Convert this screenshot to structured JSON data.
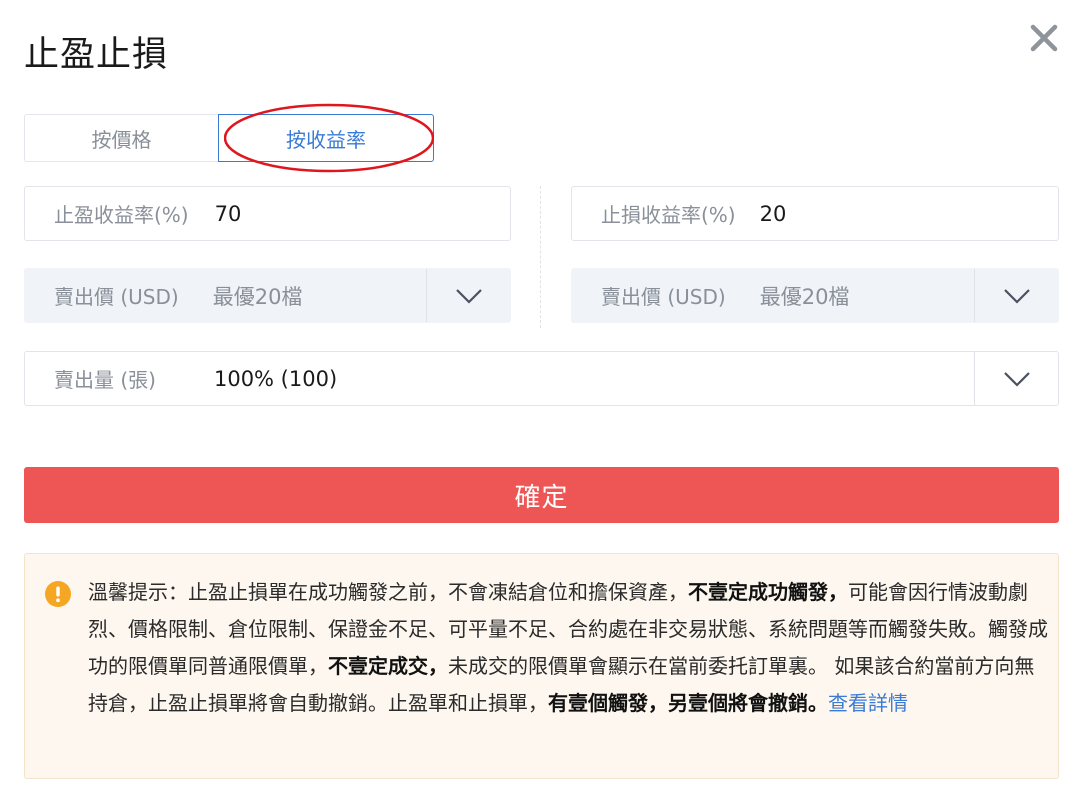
{
  "dialog": {
    "title": "止盈止損"
  },
  "tabs": [
    {
      "label": "按價格"
    },
    {
      "label": "按收益率",
      "active": true
    }
  ],
  "take_profit": {
    "label": "止盈收益率(%)",
    "value": "70"
  },
  "stop_loss": {
    "label": "止損收益率(%)",
    "value": "20"
  },
  "tp_sell_price": {
    "label": "賣出價 (USD)",
    "value": "最優20檔"
  },
  "sl_sell_price": {
    "label": "賣出價 (USD)",
    "value": "最優20檔"
  },
  "sell_qty": {
    "label": "賣出量 (張)",
    "value": "100% (100)"
  },
  "confirm_label": "確定",
  "notice": {
    "p1": "溫馨提示：止盈止損單在成功觸發之前，不會凍結倉位和擔保資產，",
    "b1": "不壹定成功觸發，",
    "p2": "可能會因行情波動劇烈、價格限制、倉位限制、保證金不足、可平量不足、合約處在非交易狀態、系統問題等而觸發失敗。觸發成功的限價單同普通限價單，",
    "b2": "不壹定成交，",
    "p3": "未成交的限價單會顯示在當前委托訂單裏。 如果該合約當前方向無持倉，止盈止損單將會自動撤銷。止盈單和止損單，",
    "b3": "有壹個觸發，另壹個將會撤銷。",
    "link": "查看詳情"
  },
  "colors": {
    "accent": "#3a7bd5",
    "confirm": "#ee5656",
    "annotation": "#e0161e",
    "warning": "#f5a623"
  }
}
